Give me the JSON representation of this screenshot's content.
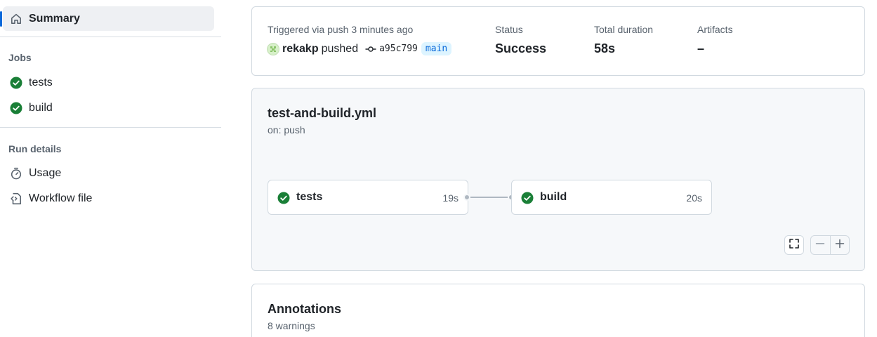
{
  "sidebar": {
    "summary_label": "Summary",
    "jobs_heading": "Jobs",
    "jobs": [
      {
        "label": "tests",
        "status": "success"
      },
      {
        "label": "build",
        "status": "success"
      }
    ],
    "run_details_heading": "Run details",
    "run_details": [
      {
        "label": "Usage",
        "icon": "stopwatch-icon"
      },
      {
        "label": "Workflow file",
        "icon": "file-code-icon"
      }
    ]
  },
  "summary": {
    "trigger_text": "Triggered via push 3 minutes ago",
    "author": "rekakp",
    "action": "pushed",
    "commit_sha": "a95c799",
    "branch": "main",
    "status_label": "Status",
    "status_value": "Success",
    "duration_label": "Total duration",
    "duration_value": "58s",
    "artifacts_label": "Artifacts",
    "artifacts_value": "–"
  },
  "workflow": {
    "file_name": "test-and-build.yml",
    "trigger": "on: push",
    "jobs": [
      {
        "name": "tests",
        "duration": "19s",
        "status": "success"
      },
      {
        "name": "build",
        "duration": "20s",
        "status": "success"
      }
    ]
  },
  "annotations": {
    "title": "Annotations",
    "count_text": "8 warnings"
  },
  "colors": {
    "success": "#1a7f37",
    "accent": "#0969da",
    "muted": "#59636e"
  }
}
